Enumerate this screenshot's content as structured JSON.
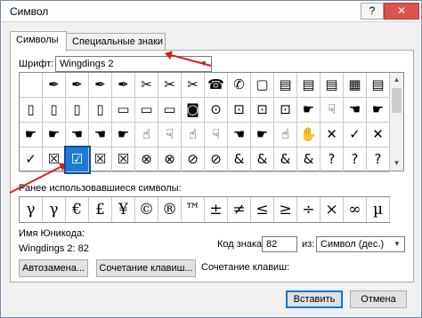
{
  "window": {
    "title": "Символ",
    "help_glyph": "?",
    "close_glyph": "✕"
  },
  "tabs": [
    {
      "label": "Символы",
      "active": true
    },
    {
      "label": "Специальные знаки",
      "active": false
    }
  ],
  "font": {
    "label": "Шрифт:",
    "value": "Wingdings 2"
  },
  "grid": {
    "rows": [
      [
        "",
        "✒",
        "✒",
        "✒",
        "✒",
        "✂",
        "✂",
        "✂",
        "☎",
        "✆",
        "▢",
        "▤",
        "▤",
        "▤",
        "▦",
        "▤"
      ],
      [
        "▯",
        "▯",
        "▯",
        "▯",
        "▭",
        "▭",
        "▭",
        "◙",
        "⊙",
        "⊡",
        "⊡",
        "⊡",
        "☛",
        "☟",
        "☚",
        "☛"
      ],
      [
        "☛",
        "☛",
        "☚",
        "☚",
        "☛",
        "☝",
        "☟",
        "☝",
        "☟",
        "☚",
        "☛",
        "☝",
        "✋",
        "✕",
        "✓",
        "✕"
      ],
      [
        "✓",
        "☒",
        "☑",
        "☒",
        "☒",
        "⊗",
        "⊗",
        "⊘",
        "⊘",
        "&",
        "&",
        "&",
        "&",
        "?",
        "?",
        "?"
      ]
    ],
    "selected_index": 50
  },
  "recent": {
    "label": "Ранее использовавшиеся символы:",
    "symbols": [
      "γ",
      "γ",
      "€",
      "£",
      "¥",
      "©",
      "®",
      "™",
      "±",
      "≠",
      "≤",
      "≥",
      "÷",
      "×",
      "∞",
      "µ"
    ]
  },
  "unicode_name": {
    "label": "Имя Юникода:",
    "value": "Wingdings 2: 82"
  },
  "char_code": {
    "label": "Код знака:",
    "value": "82"
  },
  "from": {
    "label": "из:",
    "value": "Символ (дес.)"
  },
  "buttons": {
    "autocorrect": "Автозамена...",
    "shortcut_key": "Сочетание клавиш...",
    "shortcut_label": "Сочетание клавиш:",
    "insert": "Вставить",
    "cancel": "Отмена"
  },
  "colors": {
    "accent": "#1e7bd4",
    "annotation_arrow": "#d81f1f"
  }
}
